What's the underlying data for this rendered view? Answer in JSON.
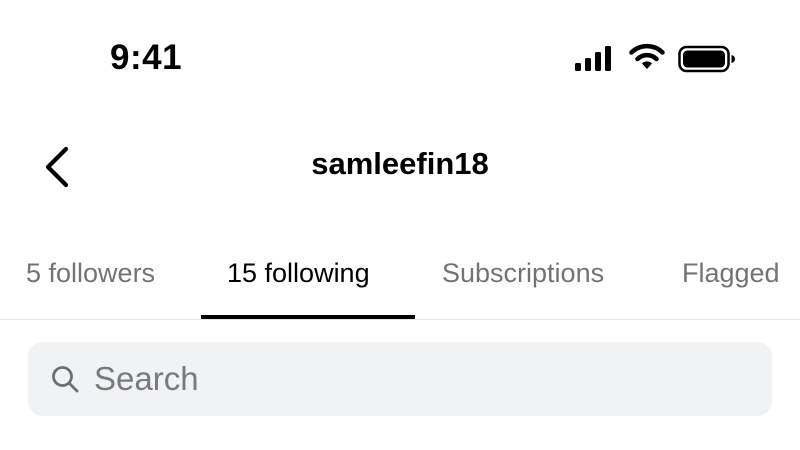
{
  "status_bar": {
    "time": "9:41",
    "icons": [
      "cellular-signal-icon",
      "wifi-icon",
      "battery-icon"
    ]
  },
  "header": {
    "title": "samleefin18",
    "back_icon": "chevron-left-icon"
  },
  "tabs": [
    {
      "label": "5 followers",
      "active": false
    },
    {
      "label": "15 following",
      "active": true
    },
    {
      "label": "Subscriptions",
      "active": false
    },
    {
      "label": "Flagged",
      "active": false
    }
  ],
  "search": {
    "placeholder": "Search",
    "value": "",
    "icon": "search-icon"
  },
  "colors": {
    "background": "#ffffff",
    "text": "#000000",
    "inactive_tab": "#737373",
    "search_bg": "#f1f2f4",
    "divider": "#e6e6e6"
  }
}
